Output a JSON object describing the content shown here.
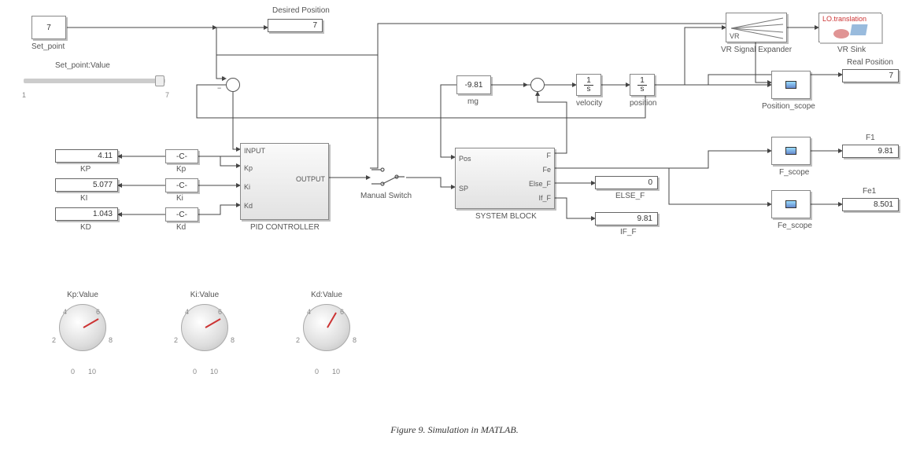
{
  "caption": "Figure 9. Simulation in MATLAB.",
  "set_point": {
    "value": "7",
    "label": "Set_point"
  },
  "desired_position": {
    "title": "Desired Position",
    "value": "7"
  },
  "slider": {
    "label": "Set_point:Value",
    "min": "1",
    "max": "7",
    "pos_pct": 96
  },
  "kp_disp": {
    "value": "4.11",
    "label": "KP"
  },
  "ki_disp": {
    "value": "5.077",
    "label": "KI"
  },
  "kd_disp": {
    "value": "1.043",
    "label": "KD"
  },
  "kp_const": {
    "value": "-C-",
    "label": "Kp"
  },
  "ki_const": {
    "value": "-C-",
    "label": "Ki"
  },
  "kd_const": {
    "value": "-C-",
    "label": "Kd"
  },
  "pid": {
    "label": "PID CONTROLLER",
    "p_in": "INPUT",
    "p_kp": "Kp",
    "p_ki": "Ki",
    "p_kd": "Kd",
    "p_out": "OUTPUT"
  },
  "switch_label": "Manual Switch",
  "sysblock": {
    "label": "SYSTEM BLOCK",
    "p_pos": "Pos",
    "p_sp": "SP",
    "p_f": "F",
    "p_fe": "Fe",
    "p_elsef": "Else_F",
    "p_iff": "If_F"
  },
  "else_f": {
    "value": "0",
    "label": "ELSE_F"
  },
  "if_f": {
    "value": "9.81",
    "label": "IF_F"
  },
  "mg": {
    "value": "-9.81",
    "label": "mg"
  },
  "velocity_label": "velocity",
  "position_label": "position",
  "position_scope_label": "Position_scope",
  "f_scope_label": "F_scope",
  "fe_scope_label": "Fe_scope",
  "vr_expander": {
    "label": "VR Signal Expander",
    "tag": "VR"
  },
  "vr_sink": {
    "label": "VR Sink",
    "overlay": "LO.translation"
  },
  "real_position": {
    "title": "Real Position",
    "value": "7"
  },
  "f1": {
    "title": "F1",
    "value": "9.81"
  },
  "fe1": {
    "title": "Fe1",
    "value": "8.501"
  },
  "knobs": {
    "kp": {
      "label": "Kp:Value",
      "ticks": [
        "0",
        "2",
        "4",
        "6",
        "8",
        "10"
      ]
    },
    "ki": {
      "label": "Ki:Value",
      "ticks": [
        "0",
        "2",
        "4",
        "6",
        "8",
        "10"
      ]
    },
    "kd": {
      "label": "Kd:Value",
      "ticks": [
        "0",
        "2",
        "4",
        "6",
        "8",
        "10"
      ]
    }
  }
}
